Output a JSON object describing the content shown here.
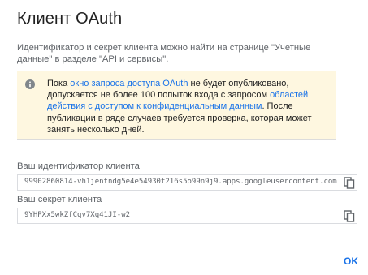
{
  "dialog": {
    "title": "Клиент OAuth",
    "description": "Идентификатор и секрет клиента можно найти на странице \"Учетные данные\" в разделе \"API и сервисы\".",
    "notice": {
      "icon": "info-icon",
      "text_1": "Пока ",
      "link_1": "окно запроса доступа OAuth",
      "text_2": " не будет опубликовано, допускается не более 100 попыток входа с запросом ",
      "link_2": "областей действия с доступом к конфиденциальным данным",
      "text_3": ". После публикации в ряде случаев требуется проверка, которая может занять несколько дней."
    },
    "client_id": {
      "label": "Ваш идентификатор клиента",
      "value": "99902860814-vh1jentndg5e4e54930t216s5o99n9j9.apps.googleusercontent.com"
    },
    "client_secret": {
      "label": "Ваш секрет клиента",
      "value": "9YHPXx5wkZfCqv7Xq41JI-w2"
    },
    "ok_label": "OK"
  },
  "colors": {
    "accent": "#1a73e8",
    "notice_background": "#fef7e0"
  }
}
